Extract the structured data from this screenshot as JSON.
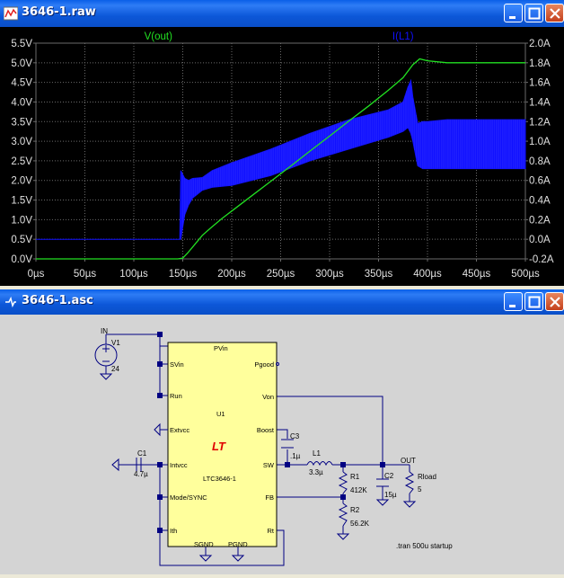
{
  "waveform_window": {
    "title": "3646-1.raw",
    "left_axis_ticks": [
      "5.5V",
      "5.0V",
      "4.5V",
      "4.0V",
      "3.5V",
      "3.0V",
      "2.5V",
      "2.0V",
      "1.5V",
      "1.0V",
      "0.5V",
      "0.0V"
    ],
    "right_axis_ticks": [
      "2.0A",
      "1.8A",
      "1.6A",
      "1.4A",
      "1.2A",
      "1.0A",
      "0.8A",
      "0.6A",
      "0.4A",
      "0.2A",
      "0.0A",
      "-0.2A"
    ],
    "x_axis_ticks": [
      "0µs",
      "50µs",
      "100µs",
      "150µs",
      "200µs",
      "250µs",
      "300µs",
      "350µs",
      "400µs",
      "450µs",
      "500µs"
    ],
    "trace_labels": {
      "vout": "V(out)",
      "il1": "I(L1)"
    },
    "colors": {
      "vout": "#22e022",
      "il1": "#1010ff",
      "grid": "#6a6a6a",
      "text": "#e0e0e0"
    }
  },
  "chart_data": {
    "type": "line",
    "title": "",
    "xlabel": "",
    "ylabel_left": "",
    "ylabel_right": "",
    "xlim": [
      0,
      500
    ],
    "ylim_left": [
      0,
      5.5
    ],
    "ylim_right": [
      -0.2,
      2.0
    ],
    "series": [
      {
        "name": "V(out)",
        "axis": "left",
        "x": [
          0,
          145,
          150,
          155,
          160,
          170,
          180,
          190,
          200,
          220,
          240,
          260,
          280,
          300,
          320,
          340,
          360,
          375,
          385,
          392,
          400,
          420,
          500
        ],
        "y": [
          0,
          0,
          0.02,
          0.15,
          0.3,
          0.6,
          0.82,
          1.03,
          1.22,
          1.6,
          1.98,
          2.36,
          2.75,
          3.13,
          3.52,
          3.9,
          4.3,
          4.62,
          4.95,
          5.1,
          5.05,
          5.0,
          5.0
        ]
      },
      {
        "name": "I(L1)",
        "axis": "right",
        "envelope": true,
        "x": [
          0,
          147,
          148,
          152,
          156,
          160,
          170,
          180,
          200,
          240,
          280,
          320,
          360,
          375,
          380,
          383,
          385,
          390,
          395,
          400,
          420,
          450,
          500
        ],
        "upper": [
          0.0,
          0.0,
          0.7,
          0.62,
          0.6,
          0.62,
          0.63,
          0.7,
          0.78,
          0.92,
          1.08,
          1.22,
          1.32,
          1.4,
          1.55,
          1.62,
          1.45,
          1.18,
          1.2,
          1.2,
          1.22,
          1.22,
          1.22
        ],
        "lower": [
          0.0,
          0.0,
          0.0,
          0.25,
          0.35,
          0.42,
          0.5,
          0.53,
          0.55,
          0.65,
          0.8,
          0.92,
          1.04,
          1.1,
          1.14,
          1.08,
          1.0,
          0.75,
          0.72,
          0.72,
          0.72,
          0.72,
          0.72
        ]
      }
    ],
    "grid": true
  },
  "schematic_window": {
    "title": "3646-1.asc",
    "chip": {
      "name": "U1",
      "part": "LTC3646-1",
      "logo": "LT",
      "pins_left": [
        "SVin",
        "Run",
        "Extvcc",
        "Intvcc",
        "Mode/SYNC",
        "Ith"
      ],
      "pins_right": [
        "Pgood",
        "Von",
        "Boost",
        "SW",
        "FB",
        "Rt"
      ],
      "pin_top": "PVin",
      "pins_bottom": [
        "SGND",
        "PGND"
      ]
    },
    "source": {
      "name": "V1",
      "value": "24",
      "net": "IN"
    },
    "components": {
      "c1": {
        "name": "C1",
        "value": "4.7µ"
      },
      "c3": {
        "name": "C3",
        "value": ".1µ"
      },
      "l1": {
        "name": "L1",
        "value": "3.3µ"
      },
      "r1": {
        "name": "R1",
        "value": "412K"
      },
      "r2": {
        "name": "R2",
        "value": "56.2K"
      },
      "c2": {
        "name": "C2",
        "value": "15µ"
      },
      "rload": {
        "name": "Rload",
        "value": "5"
      }
    },
    "out_label": "OUT",
    "directive": ".tran 500u startup"
  }
}
